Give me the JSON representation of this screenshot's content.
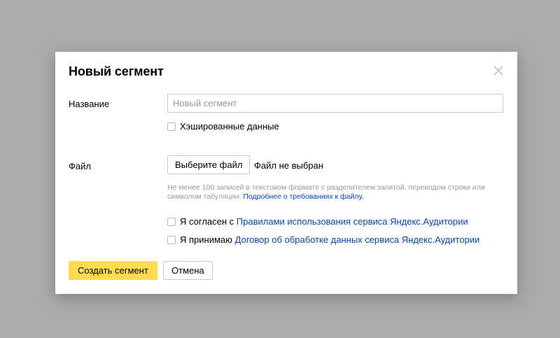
{
  "modal": {
    "title": "Новый сегмент",
    "close_icon": "close-icon"
  },
  "form": {
    "name_label": "Название",
    "name_placeholder": "Новый сегмент",
    "name_value": "",
    "hashed_label": "Хэшированные данные",
    "hashed_checked": false,
    "file_label": "Файл",
    "file_button_label": "Выберите файл",
    "file_status": "Файл не выбран",
    "hint_text": "Не менее 100 записей в текстовом формате с разделителем запятой, переводом строки или символом табуляции.",
    "hint_link": "Подробнее о требованиях к файлу.",
    "agree_prefix": "Я согласен с",
    "agree_link": "Правилами использования сервиса Яндекс.Аудитории",
    "agree_checked": false,
    "accept_prefix": "Я принимаю",
    "accept_link": "Договор об обработке данных сервиса Яндекс.Аудитории",
    "accept_checked": false
  },
  "actions": {
    "create_label": "Создать сегмент",
    "cancel_label": "Отмена"
  },
  "colors": {
    "accent": "#ffdb4d",
    "link": "#0044bb",
    "overlay": "#ababab"
  }
}
